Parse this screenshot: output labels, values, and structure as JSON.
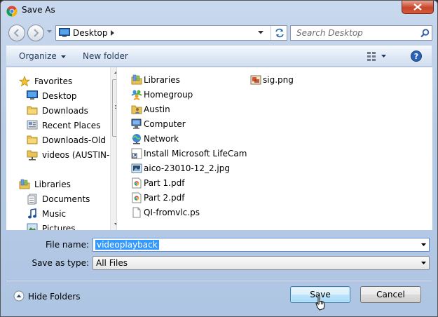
{
  "window": {
    "title": "Save As"
  },
  "address": {
    "location": "Desktop"
  },
  "search": {
    "placeholder": "Search Desktop"
  },
  "toolbar": {
    "organize_label": "Organize",
    "new_folder_label": "New folder"
  },
  "nav": {
    "items": [
      {
        "label": "Favorites",
        "icon": "star-icon"
      },
      {
        "label": "Desktop",
        "icon": "desktop-icon"
      },
      {
        "label": "Downloads",
        "icon": "folder-icon"
      },
      {
        "label": "Recent Places",
        "icon": "recent-places-icon"
      },
      {
        "label": "Downloads-Old",
        "icon": "folder-icon"
      },
      {
        "label": "videos (AUSTIN-l",
        "icon": "network-folder-icon"
      },
      {
        "label": "Libraries",
        "icon": "libraries-icon"
      },
      {
        "label": "Documents",
        "icon": "documents-icon"
      },
      {
        "label": "Music",
        "icon": "music-icon"
      },
      {
        "label": "Pictures",
        "icon": "pictures-icon"
      }
    ]
  },
  "files": [
    {
      "label": "Libraries",
      "icon": "libraries-icon"
    },
    {
      "label": "Homegroup",
      "icon": "homegroup-icon"
    },
    {
      "label": "Austin",
      "icon": "user-folder-icon"
    },
    {
      "label": "Computer",
      "icon": "computer-icon"
    },
    {
      "label": "Network",
      "icon": "network-icon"
    },
    {
      "label": "Install Microsoft LifeCam",
      "icon": "shortcut-icon"
    },
    {
      "label": "aico-23010-12_2.jpg",
      "icon": "image-file-icon"
    },
    {
      "label": "Part 1.pdf",
      "icon": "pdf-file-icon"
    },
    {
      "label": "Part 2.pdf",
      "icon": "pdf-file-icon"
    },
    {
      "label": "QI-fromvlc.ps",
      "icon": "blank-file-icon"
    },
    {
      "label": "sig.png",
      "icon": "image-file-icon"
    }
  ],
  "form": {
    "file_name_label": "File name:",
    "file_name_value": "videoplayback",
    "save_type_label": "Save as type:",
    "save_type_value": "All Files"
  },
  "footer": {
    "hide_folders_label": "Hide Folders",
    "save_label": "Save",
    "cancel_label": "Cancel"
  }
}
